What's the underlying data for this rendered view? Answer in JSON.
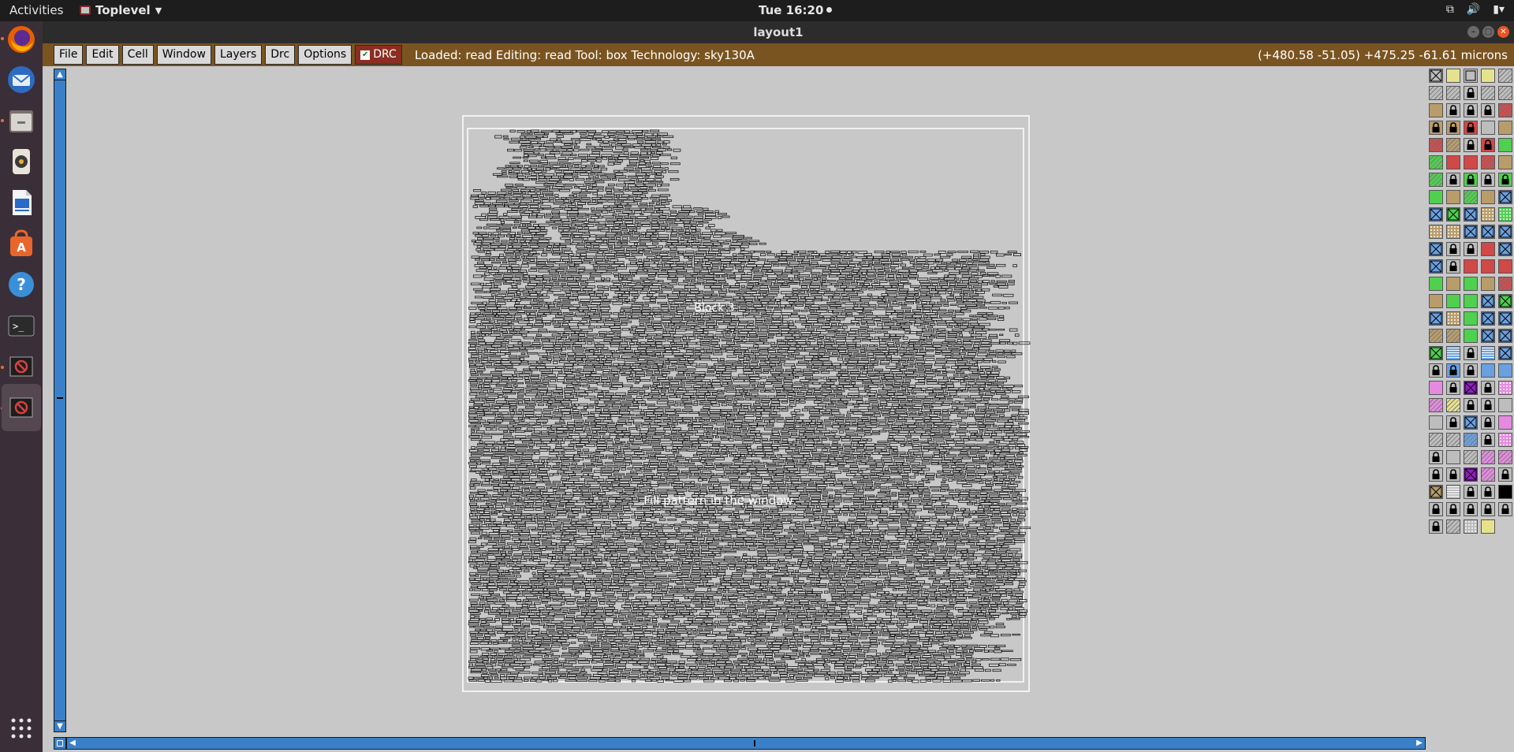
{
  "topbar": {
    "activities": "Activities",
    "app_name": "Toplevel",
    "clock": "Tue 16:20"
  },
  "dock": {
    "items": [
      {
        "name": "firefox",
        "icon": "firefox-icon"
      },
      {
        "name": "thunderbird",
        "icon": "mail-icon"
      },
      {
        "name": "files",
        "icon": "files-icon"
      },
      {
        "name": "rhythmbox",
        "icon": "music-icon"
      },
      {
        "name": "writer",
        "icon": "document-icon"
      },
      {
        "name": "software",
        "icon": "store-icon"
      },
      {
        "name": "help",
        "icon": "help-icon"
      },
      {
        "name": "terminal",
        "icon": "terminal-icon"
      },
      {
        "name": "magic-1",
        "icon": "no-entry-icon"
      },
      {
        "name": "magic-2",
        "icon": "no-entry-icon"
      }
    ],
    "show_apps": "apps-grid-icon"
  },
  "window": {
    "title": "layout1"
  },
  "menubar": {
    "file": "File",
    "edit": "Edit",
    "cell": "Cell",
    "window": "Window",
    "layers": "Layers",
    "drc_menu": "Drc",
    "options": "Options",
    "drc_toggle": "DRC",
    "status": "Loaded: read Editing: read Tool: box  Technology: sky130A",
    "coords": "(+480.58 -51.05) +475.25 -61.61 microns"
  },
  "canvas": {
    "label_top": "Block 3",
    "label_bottom": "Fill pattern in the window"
  },
  "palette": {
    "colors": {
      "gray": "#bdbdbd",
      "yellow": "#e6e28c",
      "tan": "#b89c6a",
      "red": "#d04848",
      "green": "#4fd04f",
      "blue": "#6aa0e0",
      "pink": "#e58ae0",
      "purple": "#9020c0",
      "black": "#000000"
    }
  }
}
